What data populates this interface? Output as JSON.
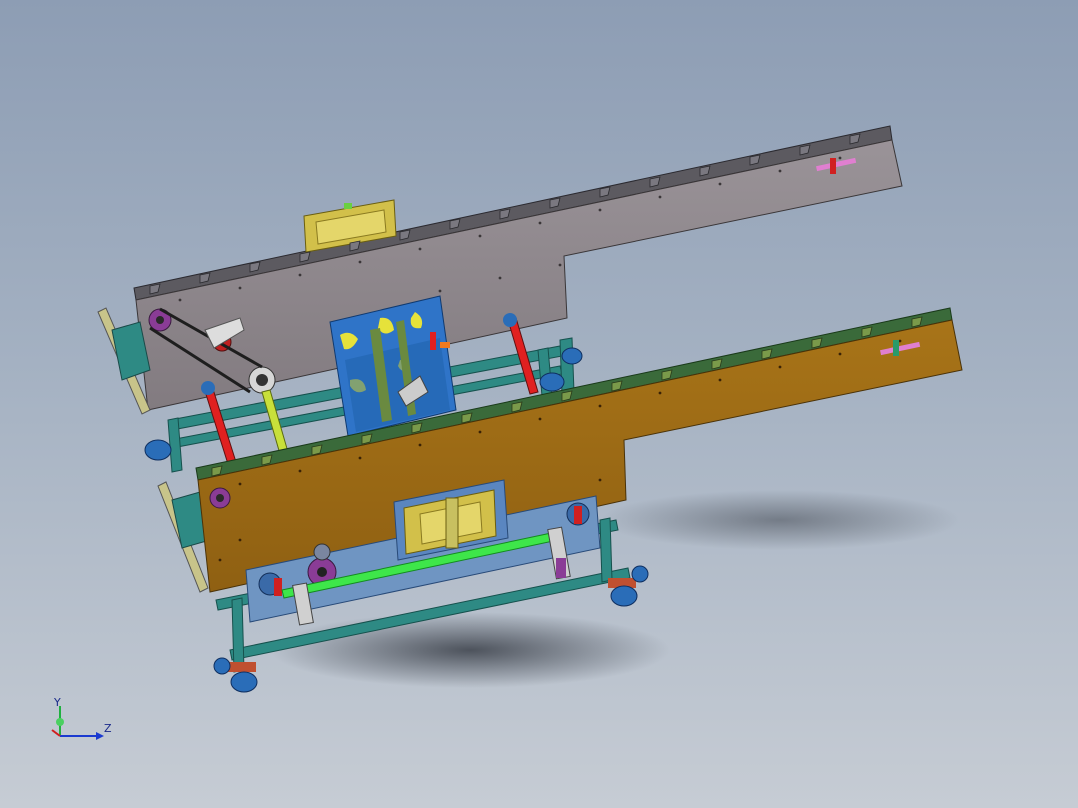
{
  "viewport": {
    "background_top": "#8d9db4",
    "background_bottom": "#c6ccd4"
  },
  "model": {
    "colors": {
      "back_plate": "#8e878c",
      "front_plate": "#9b6a16",
      "frame": "#2e8a84",
      "center_block": "#2f74c8",
      "center_pattern": "#e6e23a",
      "carriage": "#6f95c2",
      "shaft_green": "#3ee64a",
      "rod_red": "#e02020",
      "rod_yellow": "#c8e03a",
      "motor_block": "#d2c04a",
      "pulley": "#8a3c96",
      "caster": "#2a6db8"
    }
  },
  "triad": {
    "x_label": "",
    "y_label": "Y",
    "z_label": "Z",
    "x_color": "#d02020",
    "y_color": "#20b040",
    "z_color": "#1a3ad0"
  }
}
